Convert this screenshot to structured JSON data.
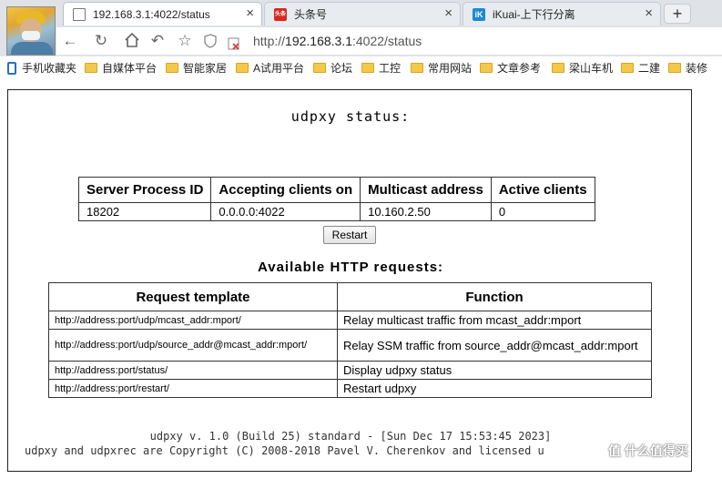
{
  "tabs": [
    {
      "title": "192.168.3.1:4022/status",
      "icon": "page-icon",
      "active": true
    },
    {
      "title": "头条号",
      "icon": "toutiao-icon",
      "active": false
    },
    {
      "title": "iKuai-上下行分离",
      "icon": "ikuai-icon",
      "active": false
    }
  ],
  "tab_icon_text": {
    "toutiao": "头条",
    "ikuai": "iK"
  },
  "new_tab_label": "+",
  "close_glyph": "×",
  "address": {
    "scheme": "http://",
    "host": "192.168.3.1",
    "rest": ":4022/status"
  },
  "bookmarks": [
    "手机收藏夹",
    "自媒体平台",
    "智能家居",
    "A试用平台",
    "论坛",
    "工控",
    "常用网站",
    "文章参考",
    "梁山车机",
    "二建",
    "装修"
  ],
  "page": {
    "title": "udpxy status:",
    "status_table": {
      "headers": [
        "Server Process ID",
        "Accepting clients on",
        "Multicast address",
        "Active clients"
      ],
      "row": [
        "18202",
        "0.0.0.0:4022",
        "10.160.2.50",
        "0"
      ]
    },
    "restart_button": "Restart",
    "requests_heading": "Available HTTP requests:",
    "requests_table": {
      "headers": [
        "Request template",
        "Function"
      ],
      "rows": [
        {
          "template": "http://address:port/udp/mcast_addr:mport/",
          "function": "Relay multicast traffic from mcast_addr:mport"
        },
        {
          "template": "http://address:port/udp/source_addr@mcast_addr:mport/",
          "function": "Relay SSM traffic from source_addr@mcast_addr:mport"
        },
        {
          "template": "http://address:port/status/",
          "function": "Display udpxy status"
        },
        {
          "template": "http://address:port/restart/",
          "function": "Restart udpxy"
        }
      ]
    },
    "footer_version": "udpxy v. 1.0 (Build 25) standard - [Sun Dec 17 15:53:45 2023]",
    "footer_copyright": "udpxy and udpxrec are Copyright (C) 2008-2018 Pavel V. Cherenkov and licensed u"
  },
  "watermark": "值 什么值得买",
  "colors": {
    "toutiao_red": "#d8281f",
    "ikuai_blue": "#1a8ad6",
    "folder_yellow": "#f3c94a"
  }
}
